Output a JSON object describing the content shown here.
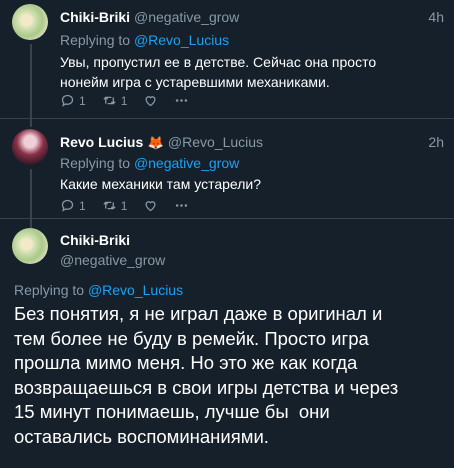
{
  "tweets": [
    {
      "name": "Chiki-Briki",
      "handle": "@negative_grow",
      "time": "4h",
      "replying_prefix": "Replying to",
      "replying_to": "@Revo_Lucius",
      "text_line1": "Увы, пропустил ее в детстве. Сейчас она просто",
      "text_line2": "нонейм игра с устаревшими механиками.",
      "reply_count": "1",
      "retweet_count": "1"
    },
    {
      "name": "Revo Lucius",
      "emoji": "🦊",
      "handle": "@Revo_Lucius",
      "time": "2h",
      "replying_prefix": "Replying to",
      "replying_to": "@negative_grow",
      "text_line1": "Какие механики там устарели?",
      "reply_count": "1",
      "retweet_count": "1"
    }
  ],
  "main_tweet": {
    "name": "Chiki-Briki",
    "handle": "@negative_grow",
    "replying_prefix": "Replying to",
    "replying_to": "@Revo_Lucius",
    "lines": [
      "Без понятия, я не играл даже в оригинал и",
      "тем более не буду в ремейк. Просто игра",
      "прошла мимо меня. Но это же как когда",
      "возвращаешься в свои игры детства и через",
      "15 минут понимаешь, лучше бы  они",
      "оставались воспоминаниями."
    ]
  },
  "colors": {
    "background": "#15202b",
    "secondary_text": "#8899a6",
    "link": "#1da1f2",
    "divider": "#38444d"
  },
  "icons": [
    "reply-icon",
    "retweet-icon",
    "like-icon",
    "more-icon"
  ]
}
